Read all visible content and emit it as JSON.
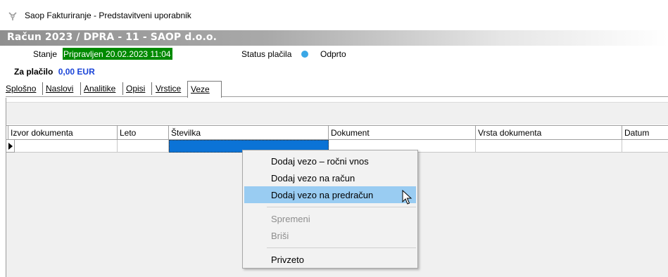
{
  "window": {
    "title": "Saop Fakturiranje - Predstavitveni uporabnik"
  },
  "document": {
    "title": "Račun  2023 / DPRA - 11 - SAOP d.o.o."
  },
  "status": {
    "state_label": "Stanje",
    "state_value": "Pripravljen 20.02.2023 11:04",
    "payment_label": "Status plačila",
    "payment_value": "Odprto",
    "payment_dot_color": "#3aa7e6"
  },
  "amount": {
    "label": "Za plačilo",
    "value": "0,00 EUR"
  },
  "tabs": [
    {
      "label": "Splošno"
    },
    {
      "label": "Naslovi"
    },
    {
      "label": "Analitike"
    },
    {
      "label": "Opisi"
    },
    {
      "label": "Vrstice"
    },
    {
      "label": "Veze",
      "active": true
    }
  ],
  "grid": {
    "columns": [
      "Izvor dokumenta",
      "Leto",
      "Številka",
      "Dokument",
      "Vrsta dokumenta",
      "Datum"
    ]
  },
  "context_menu": {
    "items": [
      {
        "label": "Dodaj vezo – ročni vnos",
        "enabled": true
      },
      {
        "label": "Dodaj vezo na račun",
        "enabled": true
      },
      {
        "label": "Dodaj vezo na predračun",
        "enabled": true,
        "highlighted": true
      },
      {
        "label": "Spremeni",
        "enabled": false
      },
      {
        "label": "Briši",
        "enabled": false
      },
      {
        "label": "Privzeto",
        "enabled": true
      }
    ]
  },
  "colors": {
    "state_bg": "#008a00",
    "amount_value": "#1a44d8",
    "selection": "#0b73d6",
    "menu_highlight": "#99ccf2"
  }
}
